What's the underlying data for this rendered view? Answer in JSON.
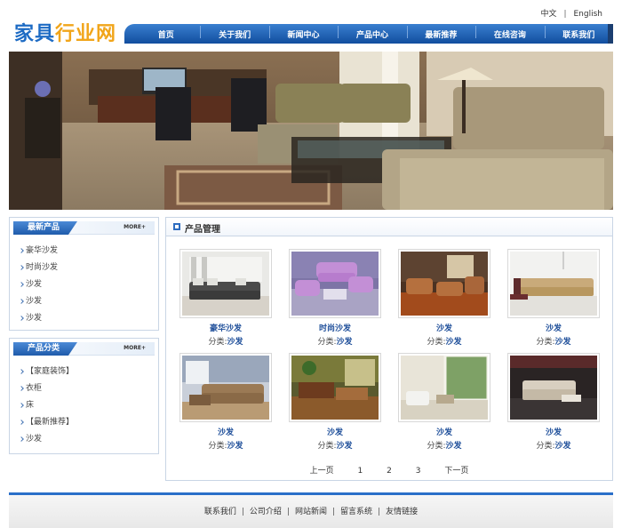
{
  "lang": {
    "zh": "中文",
    "sep": "|",
    "en": "English"
  },
  "logo": {
    "part1": "家具",
    "part2": "行业网"
  },
  "nav": [
    "首页",
    "关于我们",
    "新闻中心",
    "产品中心",
    "最新推荐",
    "在线咨询",
    "联系我们"
  ],
  "latest": {
    "title": "最新产品",
    "more": "MORE+",
    "items": [
      "豪华沙发",
      "时尚沙发",
      "沙发",
      "沙发",
      "沙发"
    ]
  },
  "category": {
    "title": "产品分类",
    "more": "MORE+",
    "items": [
      "【家庭装饰】",
      "衣柜",
      "床",
      "【最新推荐】",
      "沙发"
    ]
  },
  "main": {
    "title": "产品管理",
    "cat_prefix": "分类:",
    "products": [
      {
        "name": "豪华沙发",
        "category": "沙发",
        "scene": "sofa-grey"
      },
      {
        "name": "时尚沙发",
        "category": "沙发",
        "scene": "sofa-purple"
      },
      {
        "name": "沙发",
        "category": "沙发",
        "scene": "room-orange"
      },
      {
        "name": "沙发",
        "category": "沙发",
        "scene": "sofa-beige"
      },
      {
        "name": "沙发",
        "category": "沙发",
        "scene": "room-cream"
      },
      {
        "name": "沙发",
        "category": "沙发",
        "scene": "room-green"
      },
      {
        "name": "沙发",
        "category": "沙发",
        "scene": "room-white"
      },
      {
        "name": "沙发",
        "category": "沙发",
        "scene": "room-dark"
      }
    ],
    "pager": {
      "prev": "上一页",
      "pages": [
        "1",
        "2",
        "3"
      ],
      "next": "下一页"
    }
  },
  "footer": {
    "links": [
      "联系我们",
      "公司介绍",
      "网站新闻",
      "留言系统",
      "友情链接"
    ],
    "sep": "|"
  }
}
